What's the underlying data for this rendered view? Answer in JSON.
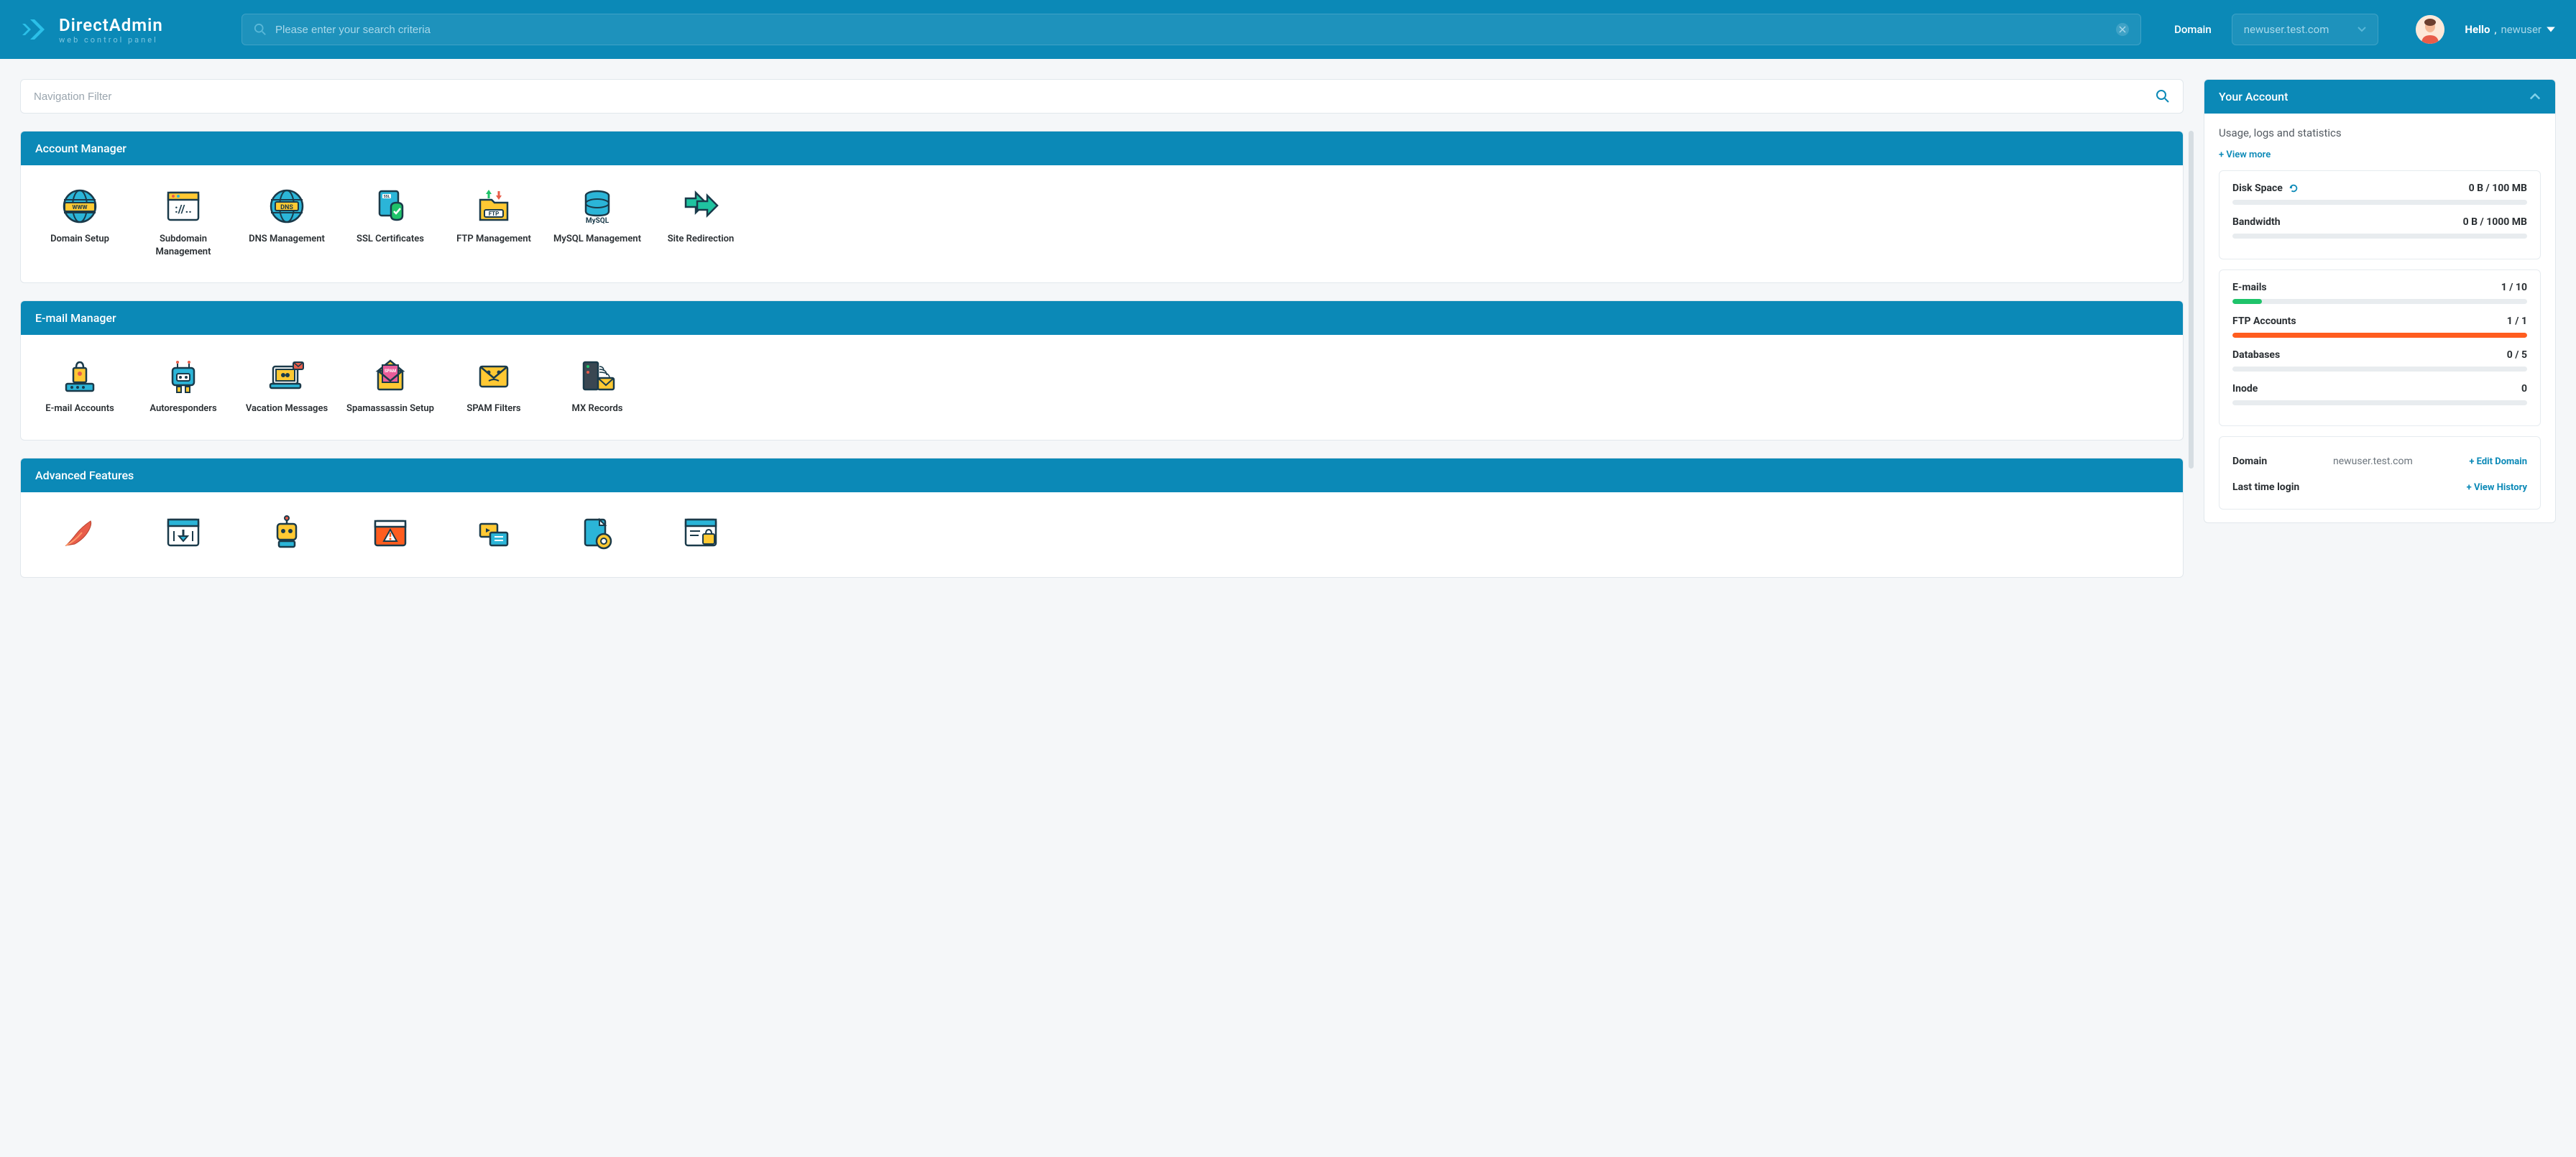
{
  "header": {
    "logo_title": "DirectAdmin",
    "logo_sub": "web control panel",
    "search_placeholder": "Please enter your search criteria",
    "domain_label": "Domain",
    "domain_selected": "newuser.test.com",
    "hello_prefix": "Hello",
    "hello_user": "newuser"
  },
  "nav_filter_placeholder": "Navigation Filter",
  "sections": {
    "account_manager": {
      "title": "Account Manager",
      "items": [
        {
          "label": "Domain Setup",
          "icon": "globe-www"
        },
        {
          "label": "Subdomain Management",
          "icon": "browser-code"
        },
        {
          "label": "DNS Management",
          "icon": "globe-dns"
        },
        {
          "label": "SSL Certificates",
          "icon": "ssl-cert"
        },
        {
          "label": "FTP Management",
          "icon": "ftp-folder"
        },
        {
          "label": "MySQL Management",
          "icon": "mysql-db"
        },
        {
          "label": "Site Redirection",
          "icon": "redirect-arrows"
        }
      ]
    },
    "email_manager": {
      "title": "E-mail Manager",
      "items": [
        {
          "label": "E-mail Accounts",
          "icon": "email-lock"
        },
        {
          "label": "Autoresponders",
          "icon": "robot"
        },
        {
          "label": "Vacation Messages",
          "icon": "laptop-mail"
        },
        {
          "label": "Spamassassin Setup",
          "icon": "spam-envelope"
        },
        {
          "label": "SPAM Filters",
          "icon": "spam-face"
        },
        {
          "label": "MX Records",
          "icon": "server-mail"
        }
      ]
    },
    "advanced": {
      "title": "Advanced Features"
    }
  },
  "account_panel": {
    "title": "Your Account",
    "subtitle": "Usage, logs and statistics",
    "view_more": "+ View more",
    "usage_stats": [
      {
        "label": "Disk Space",
        "value": "0 B / 100 MB",
        "fill": 0,
        "color": "none",
        "refresh": true
      },
      {
        "label": "Bandwidth",
        "value": "0 B / 1000 MB",
        "fill": 0,
        "color": "none"
      }
    ],
    "count_stats": [
      {
        "label": "E-mails",
        "value": "1 / 10",
        "fill": 10,
        "color": "green"
      },
      {
        "label": "FTP Accounts",
        "value": "1 / 1",
        "fill": 100,
        "color": "orange"
      },
      {
        "label": "Databases",
        "value": "0 / 5",
        "fill": 0,
        "color": "none"
      },
      {
        "label": "Inode",
        "value": "0",
        "fill": 0,
        "color": "none"
      }
    ],
    "info": [
      {
        "label": "Domain",
        "value": "newuser.test.com",
        "action": "+ Edit Domain"
      },
      {
        "label": "Last time login",
        "value": "",
        "action": "+ View History"
      }
    ]
  }
}
